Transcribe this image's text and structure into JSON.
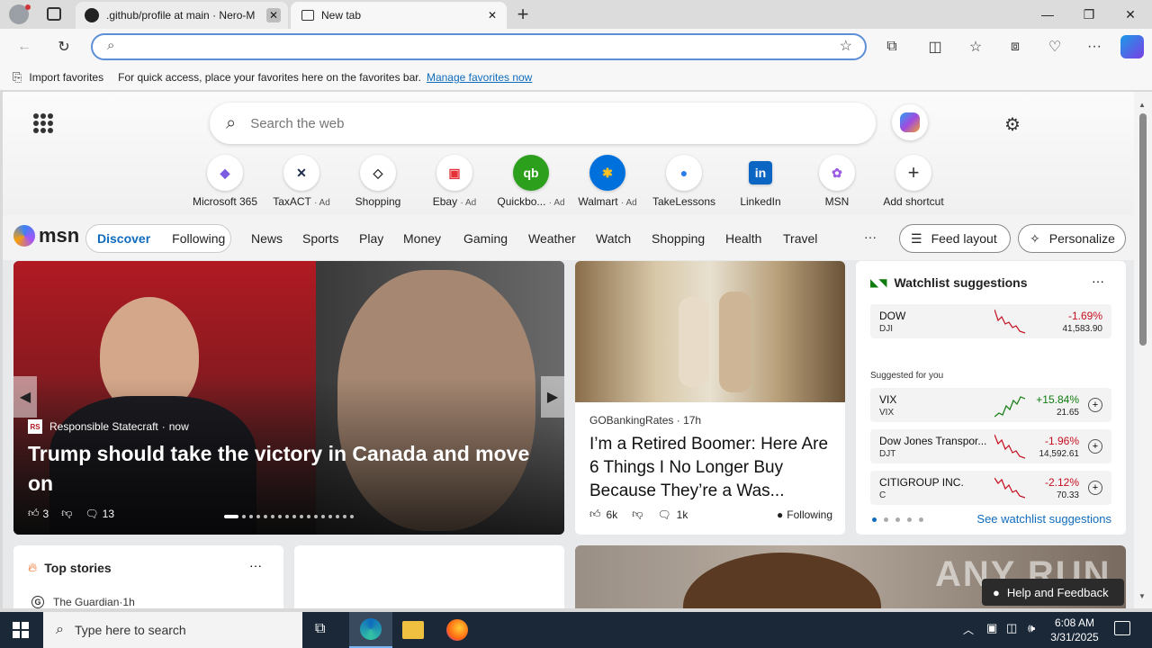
{
  "browser": {
    "tabs": [
      {
        "title": ".github/profile at main · Nero-M"
      },
      {
        "title": "New tab"
      }
    ],
    "new_tab_label": "+",
    "address": {
      "value": "",
      "placeholder": ""
    }
  },
  "favorites_bar": {
    "import_label": "Import favorites",
    "hint": "For quick access, place your favorites here on the favorites bar.",
    "manage_link": "Manage favorites now"
  },
  "newtab": {
    "search_placeholder": "Search the web",
    "shortcuts": [
      {
        "label": "Microsoft 365",
        "ad": ""
      },
      {
        "label": "TaxACT",
        "ad": "· Ad"
      },
      {
        "label": "Shopping",
        "ad": ""
      },
      {
        "label": "Ebay",
        "ad": "· Ad"
      },
      {
        "label": "Quickbo...",
        "ad": "· Ad"
      },
      {
        "label": "Walmart",
        "ad": "· Ad"
      },
      {
        "label": "TakeLessons",
        "ad": ""
      },
      {
        "label": "LinkedIn",
        "ad": ""
      },
      {
        "label": "MSN",
        "ad": ""
      },
      {
        "label": "Add shortcut",
        "ad": ""
      }
    ],
    "msn_logo": "msn",
    "feed_tabs": [
      "Discover",
      "Following"
    ],
    "nav": [
      "News",
      "Sports",
      "Play",
      "Money",
      "Gaming",
      "Weather",
      "Watch",
      "Shopping",
      "Health",
      "Travel"
    ],
    "more": "···",
    "feed_layout": "Feed layout",
    "personalize": "Personalize"
  },
  "hero_story": {
    "source": "Responsible Statecraft",
    "time": "now",
    "title": "Trump should take the victory in Canada and move on",
    "likes": "3",
    "comments": "13"
  },
  "story2": {
    "source": "GOBankingRates",
    "time": "17h",
    "title": "I’m a Retired Boomer: Here Are 6 Things I No Longer Buy Because They’re a Was...",
    "likes": "6k",
    "comments": "1k",
    "following": "Following"
  },
  "watchlist": {
    "title": "Watchlist suggestions",
    "suggested": "Suggested for you",
    "see_all": "See watchlist suggestions",
    "items": [
      {
        "name": "DOW",
        "symbol": "DJI",
        "change": "-1.69%",
        "price": "41,583.90",
        "up": false
      },
      {
        "name": "VIX",
        "symbol": "VIX",
        "change": "+15.84%",
        "price": "21.65",
        "up": true
      },
      {
        "name": "Dow Jones Transpor...",
        "symbol": "DJT",
        "change": "-1.96%",
        "price": "14,592.61",
        "up": false
      },
      {
        "name": "CITIGROUP INC.",
        "symbol": "C",
        "change": "-2.12%",
        "price": "70.33",
        "up": false
      }
    ]
  },
  "top_stories": {
    "title": "Top stories",
    "source": "The Guardian",
    "time": "1h"
  },
  "help": "Help and Feedback",
  "watermark": "ANY RUN",
  "taskbar": {
    "search_placeholder": "Type here to search",
    "time": "6:08 AM",
    "date": "3/31/2025"
  },
  "colors": {
    "accent": "#0f6cbd",
    "negative": "#c50f1f",
    "positive": "#107c10"
  }
}
